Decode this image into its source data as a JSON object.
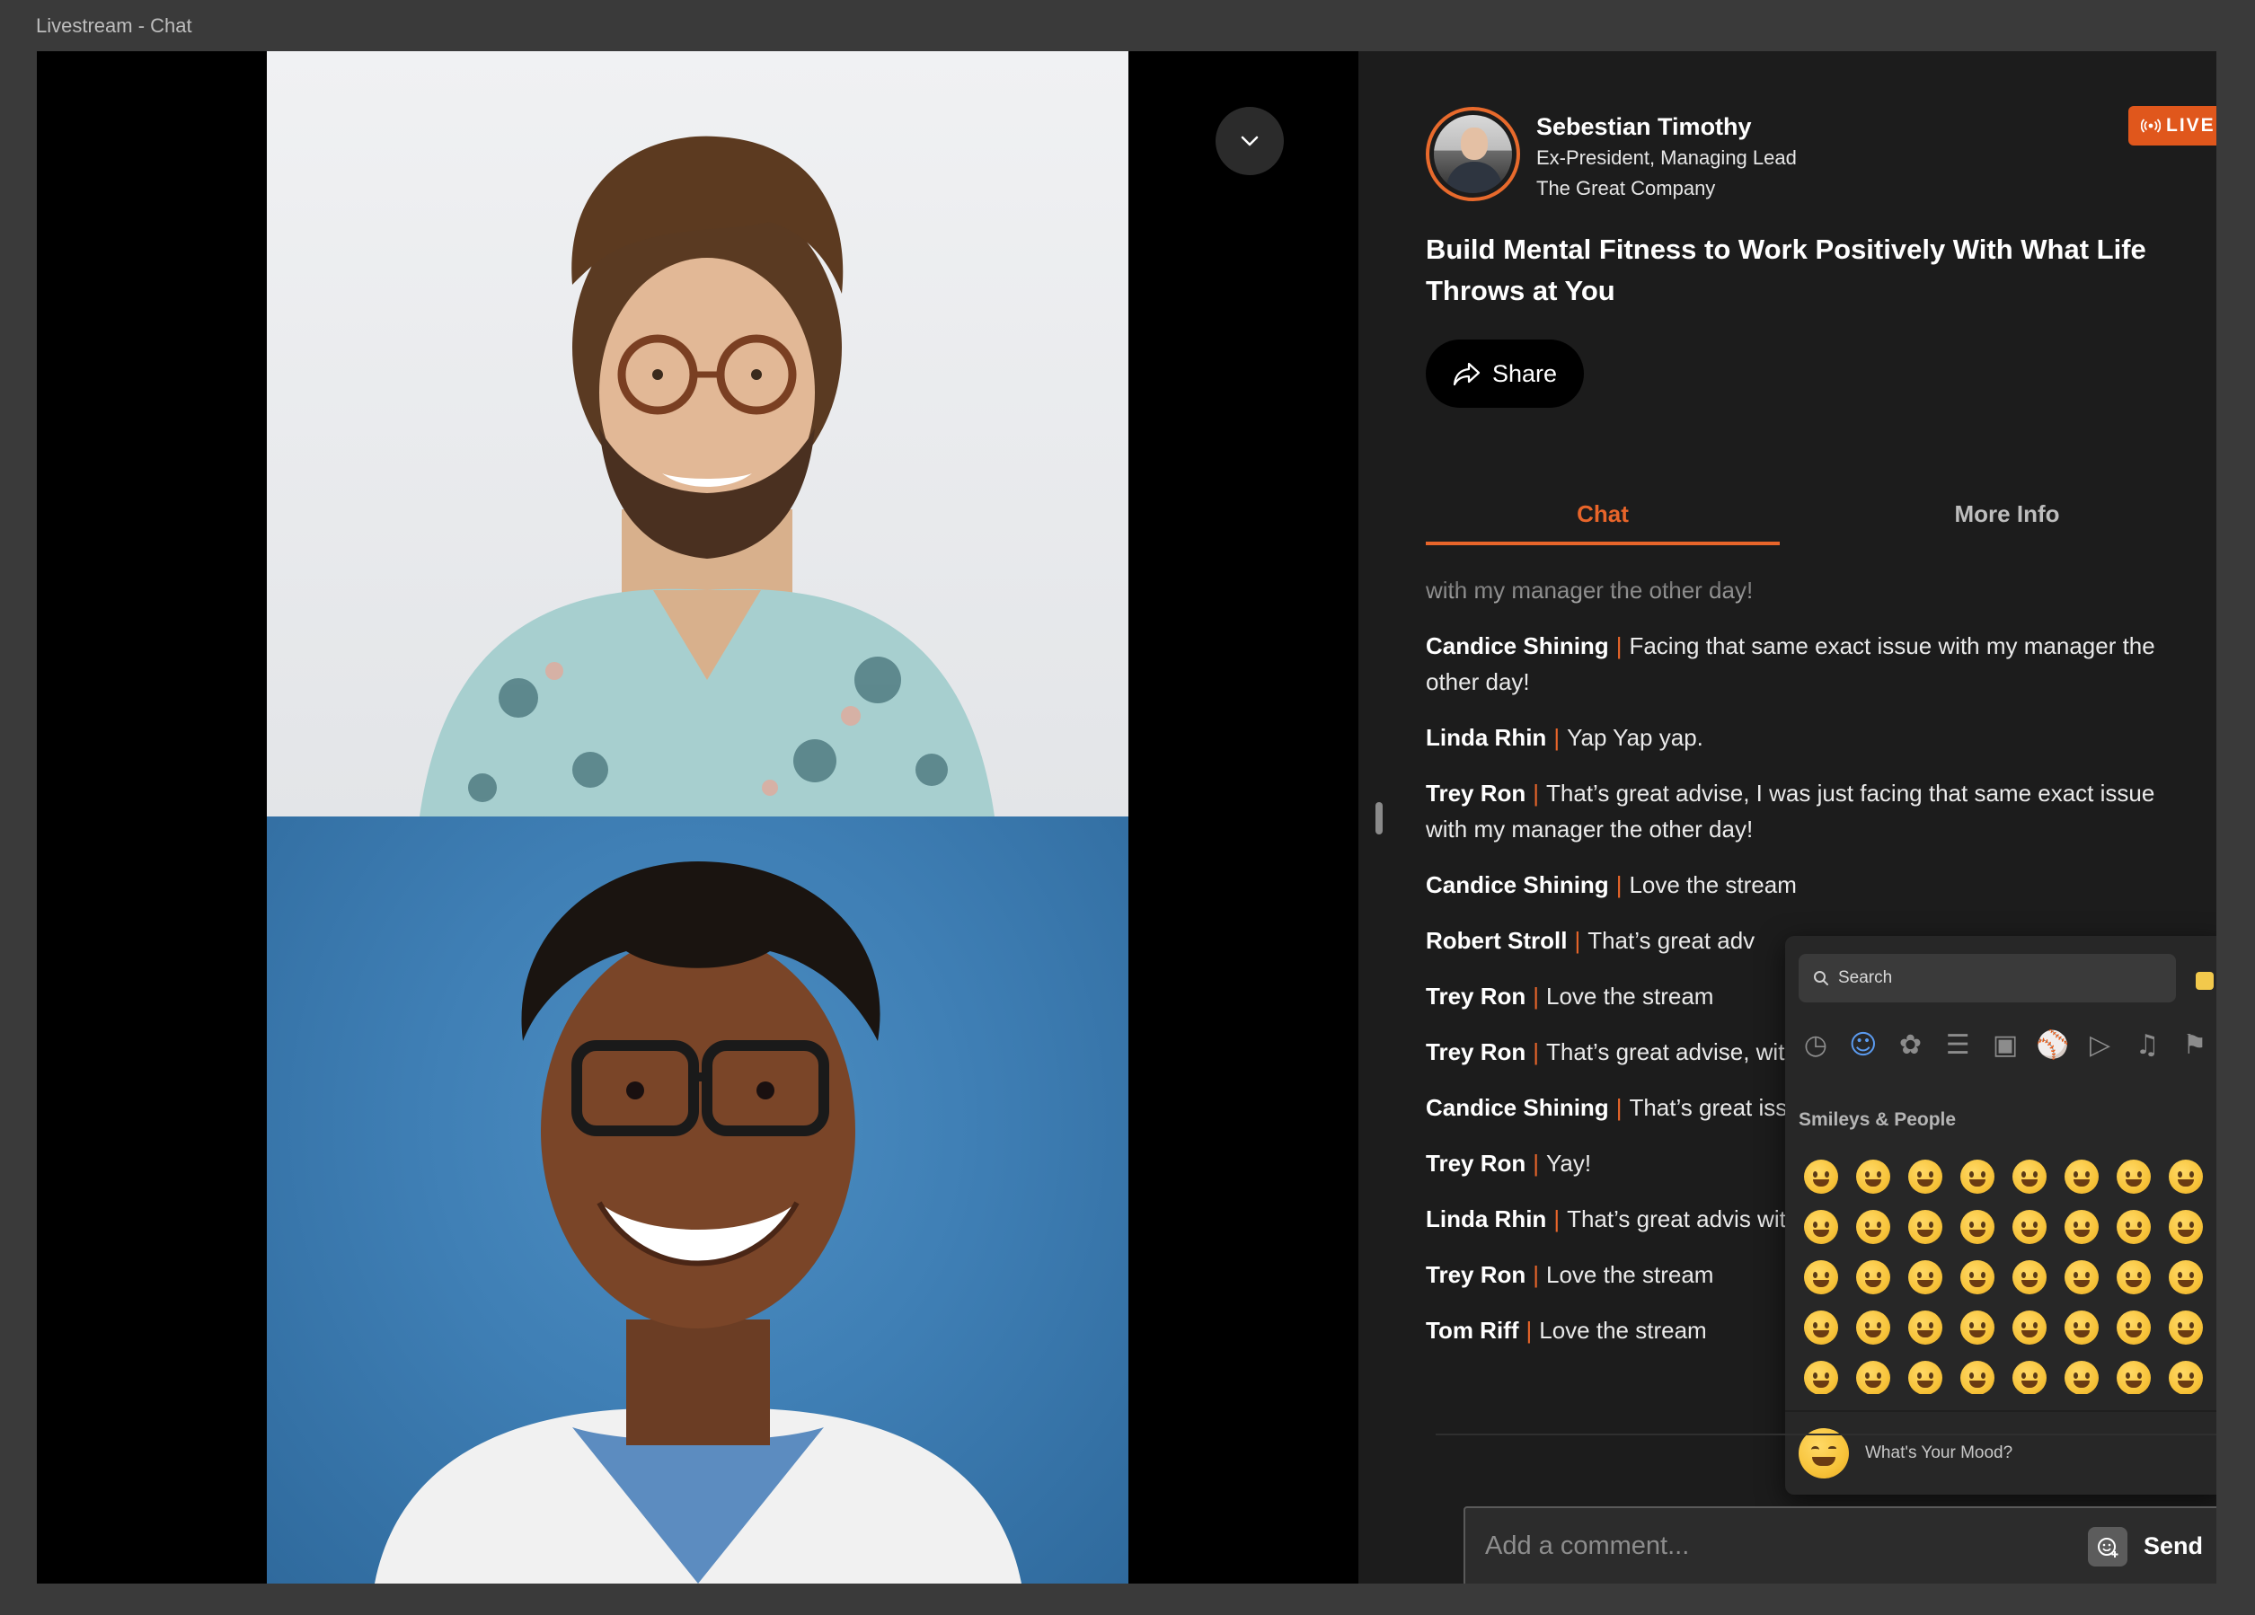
{
  "window": {
    "title": "Livestream - Chat"
  },
  "host": {
    "name": "Sebestian Timothy",
    "role": "Ex-President, Managing Lead",
    "company": "The Great Company"
  },
  "live_label": "LIVE",
  "stream_title": "Build Mental Fitness to Work Positively With What Life Throws at You",
  "share_label": "Share",
  "tabs": {
    "chat": "Chat",
    "more_info": "More Info"
  },
  "chat": {
    "partial_line": "with my manager the other day!",
    "separator": "|",
    "messages": [
      {
        "author": "Candice Shining",
        "text": "Facing that same exact issue with my manager the other day!"
      },
      {
        "author": "Linda Rhin",
        "text": "Yap Yap yap."
      },
      {
        "author": "Trey Ron",
        "text": "That’s great advise, I was just facing that same exact issue with my manager the other day!"
      },
      {
        "author": "Candice Shining",
        "text": "Love the stream"
      },
      {
        "author": "Robert Stroll",
        "text": "That’s great adv"
      },
      {
        "author": "Trey Ron",
        "text": "Love the stream"
      },
      {
        "author": "Trey Ron",
        "text": "That’s great advise, with my manager the other day"
      },
      {
        "author": "Candice Shining",
        "text": "That’s great issue with my manager the oth"
      },
      {
        "author": "Trey Ron",
        "text": "Yay!"
      },
      {
        "author": "Linda Rhin",
        "text": "That’s great advis with my manager the other day"
      },
      {
        "author": "Trey Ron",
        "text": "Love the stream"
      },
      {
        "author": "Tom Riff",
        "text": "Love the stream"
      }
    ]
  },
  "comment": {
    "placeholder": "Add a comment...",
    "send_label": "Send"
  },
  "emoji_picker": {
    "search_label": "Search",
    "section_label": "Smileys & People",
    "mood_label": "What's Your Mood?",
    "skin_tone_color": "#f2c94c",
    "category_icons": [
      "clock-icon",
      "smiley-icon",
      "cat-icon",
      "burger-icon",
      "bus-icon",
      "ball-icon",
      "shirt-icon",
      "music-icon",
      "flag-icon"
    ],
    "emoji_count": 40
  },
  "colors": {
    "accent": "#e8652a",
    "live": "#e0571c",
    "sidebar_bg": "#1c1c1c"
  }
}
